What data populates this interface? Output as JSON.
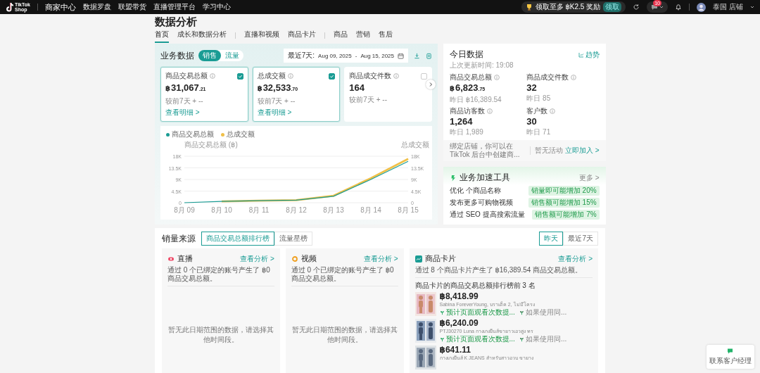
{
  "topbar": {
    "logo_lines": [
      "TikTok",
      "Shop"
    ],
    "center": "商家中心",
    "nav": [
      "数据罗盘",
      "联盟带货",
      "直播管理平台",
      "学习中心"
    ],
    "reward": {
      "text": "领取至多 ฿K2.5 奖励",
      "badge": "领取"
    },
    "messages_badge": "10",
    "shop": "泰国 店铺"
  },
  "page_title": "数据分析",
  "tab_groups": [
    {
      "tabs": [
        {
          "label": "首页",
          "selected": true
        },
        {
          "label": "成长和数据分析",
          "selected": false
        }
      ]
    },
    {
      "tabs": [
        {
          "label": "直播和视频",
          "selected": false
        },
        {
          "label": "商品卡片",
          "selected": false
        }
      ]
    },
    {
      "tabs": [
        {
          "label": "商品",
          "selected": false
        },
        {
          "label": "营销",
          "selected": false
        },
        {
          "label": "售后",
          "selected": false
        }
      ]
    }
  ],
  "business": {
    "title": "业务数据",
    "modes": [
      {
        "label": "销售",
        "selected": true
      },
      {
        "label": "流量",
        "selected": false
      }
    ],
    "date_range": {
      "preset": "最近7天:",
      "start": "Aug 09, 2025",
      "separator": "-",
      "end": "Aug 15, 2025"
    },
    "metrics": [
      {
        "label": "商品交易总额",
        "currency": "฿",
        "value": "31,067",
        "decimals": ".21",
        "compare": "较前7天 + --",
        "link": "查看明细 >",
        "checked": true
      },
      {
        "label": "总成交额",
        "currency": "฿",
        "value": "32,533",
        "decimals": ".70",
        "compare": "较前7天 + --",
        "link": "查看明细 >",
        "checked": true
      },
      {
        "label": "商品成交件数",
        "value": "164",
        "compare": "较前7天 + --",
        "checked": false
      }
    ],
    "chart_data": {
      "type": "line",
      "ylabel": "商品交易总额 (฿)",
      "y2label": "总成交额",
      "categories": [
        "8月 09",
        "8月 10",
        "8月 11",
        "8月 12",
        "8月 13",
        "8月 14",
        "8月 15"
      ],
      "series": [
        {
          "name": "商品交易总额",
          "color": "#1a9c94",
          "values": [
            0,
            500,
            800,
            1000,
            2500,
            9000,
            16000
          ]
        },
        {
          "name": "总成交额",
          "color": "#f0c048",
          "values": [
            null,
            500,
            800,
            1000,
            2700,
            9500,
            17000
          ]
        }
      ],
      "legend": "top-left",
      "grid": true,
      "ylim": [
        0,
        18000
      ],
      "y2lim": [
        0,
        18000
      ],
      "yticks": [
        {
          "value": 0,
          "label": "0"
        },
        {
          "value": 4500,
          "label": "4.5K"
        },
        {
          "value": 9000,
          "label": "9K"
        },
        {
          "value": 13500,
          "label": "13.5K"
        },
        {
          "value": 18000,
          "label": "18K"
        }
      ],
      "y2ticks": [
        {
          "value": 0,
          "label": "0"
        },
        {
          "value": 4500,
          "label": "4.5K"
        },
        {
          "value": 9000,
          "label": "9K"
        },
        {
          "value": 13500,
          "label": "13.5K"
        },
        {
          "value": 18000,
          "label": "18K"
        }
      ]
    }
  },
  "today": {
    "title": "今日数据",
    "trend_link": "趋势",
    "updated": "上次更新时间: 19:08",
    "metrics": [
      {
        "label": "商品交易总额",
        "currency": "฿",
        "value": "6,823",
        "decimals": ".75",
        "previous": "昨日 ฿16,389.54"
      },
      {
        "label": "商品成交件数",
        "value": "32",
        "previous": "昨日 85"
      },
      {
        "label": "商品访客数",
        "value": "1,264",
        "previous": "昨日 1,989"
      },
      {
        "label": "客户数",
        "value": "30",
        "previous": "昨日 71"
      }
    ],
    "notice": "绑定店铺，你可以在 TikTok 后台中创建商...",
    "activity": "暂无活动",
    "activity_link": "立即加入 >"
  },
  "accelerator": {
    "title": "业务加速工具",
    "more": "更多 >",
    "items": [
      {
        "label": "优化 个商品名称",
        "badge": "销量即可能增加 20%"
      },
      {
        "label": "发布更多可购物视频",
        "badge": "销售额可能增加 15%"
      },
      {
        "label": "通过 SEO 提高搜索流量",
        "badge": "销售额可能增加 7%"
      }
    ]
  },
  "sources": {
    "title": "销量来源",
    "rankings": [
      {
        "label": "商品交易总额排行榜",
        "selected": true
      },
      {
        "label": "流量星榜",
        "selected": false
      }
    ],
    "periods": [
      {
        "label": "昨天",
        "selected": true
      },
      {
        "label": "最近7天",
        "selected": false
      }
    ],
    "columns": [
      {
        "kind": "live",
        "title": "直播",
        "link": "查看分析 >",
        "summary": "通过 0 个已绑定的账号产生了 ฿0 商品交易总额。",
        "empty": "暂无此日期范围的数据，请选择其他时间段。"
      },
      {
        "kind": "video",
        "title": "视频",
        "link": "查看分析 >",
        "summary": "通过 0 个已绑定的账号产生了 ฿0 商品交易总额。",
        "empty": "暂无此日期范围的数据，请选择其他时间段。"
      },
      {
        "kind": "card",
        "title": "商品卡片",
        "link": "查看分析 >",
        "summary": "通过 8 个商品卡片产生了 ฿16,389.54 商品交易总额。",
        "ranking_title": "商品卡片的商品交易总额排行榜前 3 名",
        "products": [
          {
            "price": "฿8,418.99",
            "name": "Sabina ForeverYoung, บราเด็ค 2, ไม่มีโครง",
            "tags": [
              {
                "kind": "highlight",
                "text": "预计页面观看次数提..."
              },
              {
                "kind": "note",
                "text": "如果使用同..."
              }
            ]
          },
          {
            "price": "฿6,240.09",
            "name": "PTJ30270 Luna กางเกงยีนส์ขายาวเอวสูง ทร",
            "tags": [
              {
                "kind": "highlight",
                "text": "预计页面观看次数提..."
              },
              {
                "kind": "note",
                "text": "如果使用同..."
              }
            ]
          },
          {
            "price": "฿641.11",
            "name": "กางเกงยีนส์ K JEANS สำหรับสาวอวบ ขายาง"
          }
        ]
      }
    ]
  },
  "help_widget": {
    "label": "联系客户经理"
  }
}
